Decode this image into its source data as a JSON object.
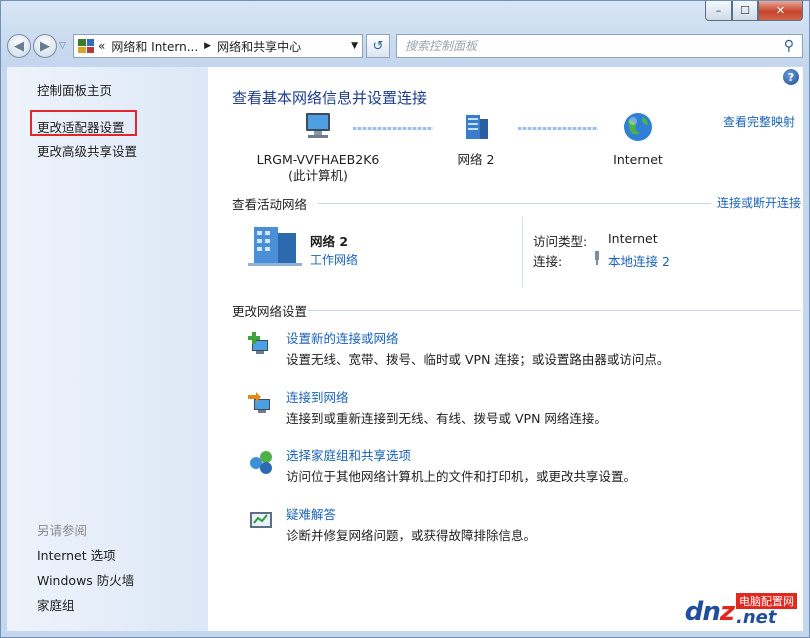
{
  "window": {
    "minimize_glyph": "–",
    "maximize_glyph": "☐",
    "close_glyph": "✕"
  },
  "nav": {
    "back_glyph": "◀",
    "forward_glyph": "▶",
    "dropdown_glyph": "▽",
    "address_prefix": "«",
    "breadcrumb": [
      "网络和 Intern...",
      "网络和共享中心"
    ],
    "breadcrumb_sep": "▶",
    "address_dropdown": "▼",
    "refresh_glyph": "↺",
    "search_placeholder": "搜索控制面板",
    "search_glyph": "⚲"
  },
  "sidebar": {
    "items": [
      "控制面板主页",
      "更改适配器设置",
      "更改高级共享设置"
    ],
    "see_also_label": "另请参阅",
    "see_also_items": [
      "Internet 选项",
      "Windows 防火墙",
      "家庭组"
    ]
  },
  "main": {
    "help_glyph": "?",
    "title": "查看基本网络信息并设置连接",
    "view_full_map": "查看完整映射",
    "map": {
      "computer_name": "LRGM-VVFHAEB2K6",
      "computer_sub": "(此计算机)",
      "network_label": "网络  2",
      "internet_label": "Internet"
    },
    "active_networks": {
      "section_title": "查看活动网络",
      "connect_link": "连接或断开连接",
      "network_name": "网络  2",
      "network_type": "工作网络",
      "access_type_label": "访问类型:",
      "access_type_value": "Internet",
      "connections_label": "连接:",
      "connections_value": "本地连接 2"
    },
    "change_settings": {
      "section_title": "更改网络设置",
      "tasks": [
        {
          "link": "设置新的连接或网络",
          "desc": "设置无线、宽带、拨号、临时或 VPN 连接；或设置路由器或访问点。",
          "icon": "new-connection-icon"
        },
        {
          "link": "连接到网络",
          "desc": "连接到或重新连接到无线、有线、拨号或 VPN 网络连接。",
          "icon": "connect-network-icon"
        },
        {
          "link": "选择家庭组和共享选项",
          "desc": "访问位于其他网络计算机上的文件和打印机，或更改共享设置。",
          "icon": "homegroup-icon"
        },
        {
          "link": "疑难解答",
          "desc": "诊断并修复网络问题，或获得故障排除信息。",
          "icon": "troubleshoot-icon"
        }
      ]
    }
  },
  "watermark": {
    "main_a": "dn",
    "main_z": "z",
    "main_b": "",
    "cn": "电脑配置网",
    "net": ".net"
  },
  "colors": {
    "link": "#1a63b8",
    "title": "#1e3c8c",
    "highlight_box": "#e2262c"
  }
}
